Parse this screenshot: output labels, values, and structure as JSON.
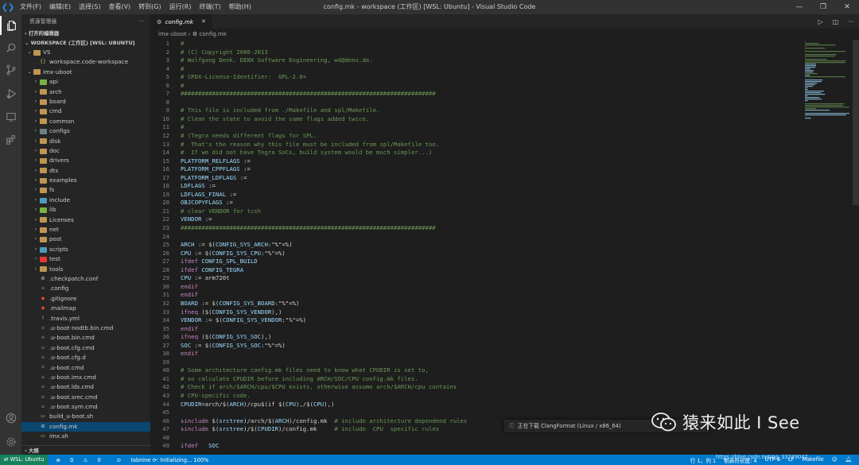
{
  "window": {
    "title": "config.mk - workspace (工作区) [WSL: Ubuntu] - Visual Studio Code",
    "menu": [
      "文件(F)",
      "编辑(E)",
      "选择(S)",
      "查看(V)",
      "转到(G)",
      "运行(R)",
      "终端(T)",
      "帮助(H)"
    ]
  },
  "sidebar": {
    "header": "资源管理器",
    "open_editors": "打开的编辑器",
    "workspace": "WORKSPACE (工作区) [WSL: UBUNTU]",
    "outline": "大纲",
    "tree": [
      {
        "label": "VS",
        "indent": 1,
        "type": "folder-open",
        "color": "#c09553"
      },
      {
        "label": "workspace.code-workspace",
        "indent": 2,
        "type": "json",
        "color": "#cbcb41"
      },
      {
        "label": "imx-uboot",
        "indent": 1,
        "type": "folder-open",
        "color": "#c09553"
      },
      {
        "label": "api",
        "indent": 2,
        "type": "folder",
        "color": "#7cb342"
      },
      {
        "label": "arch",
        "indent": 2,
        "type": "folder",
        "color": "#c09553"
      },
      {
        "label": "board",
        "indent": 2,
        "type": "folder",
        "color": "#c09553"
      },
      {
        "label": "cmd",
        "indent": 2,
        "type": "folder",
        "color": "#c09553"
      },
      {
        "label": "common",
        "indent": 2,
        "type": "folder",
        "color": "#c09553"
      },
      {
        "label": "configs",
        "indent": 2,
        "type": "folder",
        "color": "#6d8086"
      },
      {
        "label": "disk",
        "indent": 2,
        "type": "folder",
        "color": "#c09553"
      },
      {
        "label": "doc",
        "indent": 2,
        "type": "folder",
        "color": "#c09553"
      },
      {
        "label": "drivers",
        "indent": 2,
        "type": "folder",
        "color": "#c09553"
      },
      {
        "label": "dts",
        "indent": 2,
        "type": "folder",
        "color": "#c09553"
      },
      {
        "label": "examples",
        "indent": 2,
        "type": "folder",
        "color": "#c09553"
      },
      {
        "label": "fs",
        "indent": 2,
        "type": "folder",
        "color": "#c09553"
      },
      {
        "label": "include",
        "indent": 2,
        "type": "folder",
        "color": "#519aba"
      },
      {
        "label": "lib",
        "indent": 2,
        "type": "folder",
        "color": "#7cb342"
      },
      {
        "label": "Licenses",
        "indent": 2,
        "type": "folder",
        "color": "#c09553"
      },
      {
        "label": "net",
        "indent": 2,
        "type": "folder",
        "color": "#c09553"
      },
      {
        "label": "post",
        "indent": 2,
        "type": "folder",
        "color": "#c09553"
      },
      {
        "label": "scripts",
        "indent": 2,
        "type": "folder",
        "color": "#519aba"
      },
      {
        "label": "test",
        "indent": 2,
        "type": "folder",
        "color": "#e53935"
      },
      {
        "label": "tools",
        "indent": 2,
        "type": "folder",
        "color": "#c09553"
      },
      {
        "label": ".checkpatch.conf",
        "indent": 2,
        "type": "gear",
        "color": "#cccccc"
      },
      {
        "label": ".config",
        "indent": 2,
        "type": "file",
        "color": "#6d8086"
      },
      {
        "label": ".gitignore",
        "indent": 2,
        "type": "git",
        "color": "#e44d26"
      },
      {
        "label": ".mailmap",
        "indent": 2,
        "type": "git",
        "color": "#e44d26"
      },
      {
        "label": ".travis.yml",
        "indent": 2,
        "type": "yml",
        "color": "#cccccc"
      },
      {
        "label": ".u-boot-nodtb.bin.cmd",
        "indent": 2,
        "type": "file",
        "color": "#6d8086"
      },
      {
        "label": ".u-boot.bin.cmd",
        "indent": 2,
        "type": "file",
        "color": "#6d8086"
      },
      {
        "label": ".u-boot.cfg.cmd",
        "indent": 2,
        "type": "file",
        "color": "#6d8086"
      },
      {
        "label": ".u-boot.cfg.d",
        "indent": 2,
        "type": "file",
        "color": "#6d8086"
      },
      {
        "label": ".u-boot.cmd",
        "indent": 2,
        "type": "file",
        "color": "#6d8086"
      },
      {
        "label": ".u-boot.imx.cmd",
        "indent": 2,
        "type": "file",
        "color": "#6d8086"
      },
      {
        "label": ".u-boot.lds.cmd",
        "indent": 2,
        "type": "file",
        "color": "#6d8086"
      },
      {
        "label": ".u-boot.srec.cmd",
        "indent": 2,
        "type": "file",
        "color": "#6d8086"
      },
      {
        "label": ".u-boot.sym.cmd",
        "indent": 2,
        "type": "file",
        "color": "#6d8086"
      },
      {
        "label": "build_u-boot.sh",
        "indent": 2,
        "type": "sh",
        "color": "#cbcb41"
      },
      {
        "label": "config.mk",
        "indent": 2,
        "type": "gear",
        "color": "#cccccc",
        "selected": true
      },
      {
        "label": "imx.sh",
        "indent": 2,
        "type": "sh",
        "color": "#cbcb41"
      }
    ]
  },
  "editor": {
    "tab": "config.mk",
    "breadcrumb": [
      "imx-uboot",
      "config.mk"
    ],
    "lines": [
      {
        "n": "1",
        "t": [
          [
            "c",
            "#"
          ]
        ]
      },
      {
        "n": "2",
        "t": [
          [
            "c",
            "# (C) Copyright 2000-2013"
          ]
        ]
      },
      {
        "n": "3",
        "t": [
          [
            "c",
            "# Wolfgang Denk, DENX Software Engineering, wd@denx.de."
          ]
        ]
      },
      {
        "n": "4",
        "t": [
          [
            "c",
            "#"
          ]
        ]
      },
      {
        "n": "5",
        "t": [
          [
            "c",
            "# SPDX-License-Identifier:  GPL-2.0+"
          ]
        ]
      },
      {
        "n": "6",
        "t": [
          [
            "c",
            "#"
          ]
        ]
      },
      {
        "n": "7",
        "t": [
          [
            "c",
            "#########################################################################"
          ]
        ]
      },
      {
        "n": "8",
        "t": []
      },
      {
        "n": "9",
        "t": [
          [
            "c",
            "# This file is included from ./Makefile and spl/Makefile."
          ]
        ]
      },
      {
        "n": "10",
        "t": [
          [
            "c",
            "# Clean the state to avoid the same flags added twice."
          ]
        ]
      },
      {
        "n": "11",
        "t": [
          [
            "c",
            "#"
          ]
        ]
      },
      {
        "n": "12",
        "t": [
          [
            "c",
            "# (Tegra needs different flags for SPL."
          ]
        ]
      },
      {
        "n": "13",
        "t": [
          [
            "c",
            "#  That's the reason why this file must be included from spl/Makefile too."
          ]
        ]
      },
      {
        "n": "14",
        "t": [
          [
            "c",
            "#  If we did not have Tegra SoCs, build system would be much simpler...)"
          ]
        ]
      },
      {
        "n": "15",
        "t": [
          [
            "v",
            "PLATFORM_RELFLAGS"
          ],
          [
            "x",
            " :="
          ]
        ]
      },
      {
        "n": "16",
        "t": [
          [
            "v",
            "PLATFORM_CPPFLAGS"
          ],
          [
            "x",
            " :="
          ]
        ]
      },
      {
        "n": "17",
        "t": [
          [
            "v",
            "PLATFORM_LDFLAGS"
          ],
          [
            "x",
            " :="
          ]
        ]
      },
      {
        "n": "18",
        "t": [
          [
            "v",
            "LDFLAGS"
          ],
          [
            "x",
            " :="
          ]
        ]
      },
      {
        "n": "19",
        "t": [
          [
            "v",
            "LDFLAGS_FINAL"
          ],
          [
            "x",
            " :="
          ]
        ]
      },
      {
        "n": "20",
        "t": [
          [
            "v",
            "OBJCOPYFLAGS"
          ],
          [
            "x",
            " :="
          ]
        ]
      },
      {
        "n": "21",
        "t": [
          [
            "c",
            "# clear VENDOR for tcsh"
          ]
        ]
      },
      {
        "n": "22",
        "t": [
          [
            "v",
            "VENDOR"
          ],
          [
            "x",
            " :="
          ]
        ]
      },
      {
        "n": "23",
        "t": [
          [
            "c",
            "#########################################################################"
          ]
        ]
      },
      {
        "n": "24",
        "t": []
      },
      {
        "n": "25",
        "t": [
          [
            "v",
            "ARCH"
          ],
          [
            "x",
            " := $("
          ],
          [
            "v",
            "CONFIG_SYS_ARCH"
          ],
          [
            "x",
            ":\"%\"=%)"
          ]
        ]
      },
      {
        "n": "26",
        "t": [
          [
            "v",
            "CPU"
          ],
          [
            "x",
            " := $("
          ],
          [
            "v",
            "CONFIG_SYS_CPU"
          ],
          [
            "x",
            ":\"%\"=%)"
          ]
        ]
      },
      {
        "n": "27",
        "t": [
          [
            "k",
            "ifdef"
          ],
          [
            "x",
            " "
          ],
          [
            "v",
            "CONFIG_SPL_BUILD"
          ]
        ]
      },
      {
        "n": "28",
        "t": [
          [
            "k",
            "ifdef"
          ],
          [
            "x",
            " "
          ],
          [
            "v",
            "CONFIG_TEGRA"
          ]
        ]
      },
      {
        "n": "29",
        "t": [
          [
            "v",
            "CPU"
          ],
          [
            "x",
            " := arm720t"
          ]
        ]
      },
      {
        "n": "30",
        "t": [
          [
            "k",
            "endif"
          ]
        ]
      },
      {
        "n": "31",
        "t": [
          [
            "k",
            "endif"
          ]
        ]
      },
      {
        "n": "32",
        "t": [
          [
            "v",
            "BOARD"
          ],
          [
            "x",
            " := $("
          ],
          [
            "v",
            "CONFIG_SYS_BOARD"
          ],
          [
            "x",
            ":\"%\"=%)"
          ]
        ]
      },
      {
        "n": "33",
        "t": [
          [
            "k",
            "ifneq"
          ],
          [
            "x",
            " ($("
          ],
          [
            "v",
            "CONFIG_SYS_VENDOR"
          ],
          [
            "x",
            "),)"
          ]
        ]
      },
      {
        "n": "34",
        "t": [
          [
            "v",
            "VENDOR"
          ],
          [
            "x",
            " := $("
          ],
          [
            "v",
            "CONFIG_SYS_VENDOR"
          ],
          [
            "x",
            ":\"%\"=%)"
          ]
        ]
      },
      {
        "n": "35",
        "t": [
          [
            "k",
            "endif"
          ]
        ]
      },
      {
        "n": "36",
        "t": [
          [
            "k",
            "ifneq"
          ],
          [
            "x",
            " ($("
          ],
          [
            "v",
            "CONFIG_SYS_SOC"
          ],
          [
            "x",
            "),)"
          ]
        ]
      },
      {
        "n": "37",
        "t": [
          [
            "v",
            "SOC"
          ],
          [
            "x",
            " := $("
          ],
          [
            "v",
            "CONFIG_SYS_SOC"
          ],
          [
            "x",
            ":\"%\"=%)"
          ]
        ]
      },
      {
        "n": "38",
        "t": [
          [
            "k",
            "endif"
          ]
        ]
      },
      {
        "n": "39",
        "t": []
      },
      {
        "n": "40",
        "t": [
          [
            "c",
            "# Some architecture config.mk files need to know what CPUDIR is set to,"
          ]
        ]
      },
      {
        "n": "41",
        "t": [
          [
            "c",
            "# so calculate CPUDIR before including ARCH/SOC/CPU config.mk files."
          ]
        ]
      },
      {
        "n": "42",
        "t": [
          [
            "c",
            "# Check if arch/$ARCH/cpu/$CPU exists, otherwise assume arch/$ARCH/cpu contains"
          ]
        ]
      },
      {
        "n": "43",
        "t": [
          [
            "c",
            "# CPU-specific code."
          ]
        ]
      },
      {
        "n": "44",
        "t": [
          [
            "v",
            "CPUDIR"
          ],
          [
            "x",
            "=arch/$("
          ],
          [
            "v",
            "ARCH"
          ],
          [
            "x",
            ")/cpu$(if $("
          ],
          [
            "v",
            "CPU"
          ],
          [
            "x",
            "),/$("
          ],
          [
            "v",
            "CPU"
          ],
          [
            "x",
            "),)"
          ]
        ]
      },
      {
        "n": "45",
        "t": []
      },
      {
        "n": "46",
        "t": [
          [
            "k",
            "sinclude"
          ],
          [
            "x",
            " $("
          ],
          [
            "v",
            "srctree"
          ],
          [
            "x",
            ")/arch/$("
          ],
          [
            "v",
            "ARCH"
          ],
          [
            "x",
            ")/config.mk  "
          ],
          [
            "c",
            "# include architecture dependend rules"
          ]
        ]
      },
      {
        "n": "47",
        "t": [
          [
            "k",
            "sinclude"
          ],
          [
            "x",
            " $("
          ],
          [
            "v",
            "srctree"
          ],
          [
            "x",
            ")/$("
          ],
          [
            "v",
            "CPUDIR"
          ],
          [
            "x",
            ")/config.mk     "
          ],
          [
            "c",
            "# include  CPU  specific rules"
          ]
        ]
      },
      {
        "n": "48",
        "t": []
      },
      {
        "n": "49",
        "t": [
          [
            "k",
            "ifdef"
          ],
          [
            "x",
            "   "
          ],
          [
            "v",
            "SOC"
          ]
        ]
      }
    ]
  },
  "notification": {
    "text": "正在下载 ClangFormat (Linux / x86_64)"
  },
  "watermark": {
    "text": "猿来如此 I See"
  },
  "statusbar": {
    "remote": "WSL: Ubuntu",
    "errors": "0",
    "warnings": "0",
    "tabnine": "tabnine ⟳: Initializing... 100%",
    "position": "行 1，列 1",
    "tabs": "制表符长度: 4",
    "encoding": "UTF-8",
    "eol": "LF",
    "language": "Makefile",
    "csdn": "https://blog.csdn.net/qq_33249042"
  },
  "colors": {
    "accent": "#007acc",
    "remote": "#16825d",
    "selection": "#094771"
  }
}
